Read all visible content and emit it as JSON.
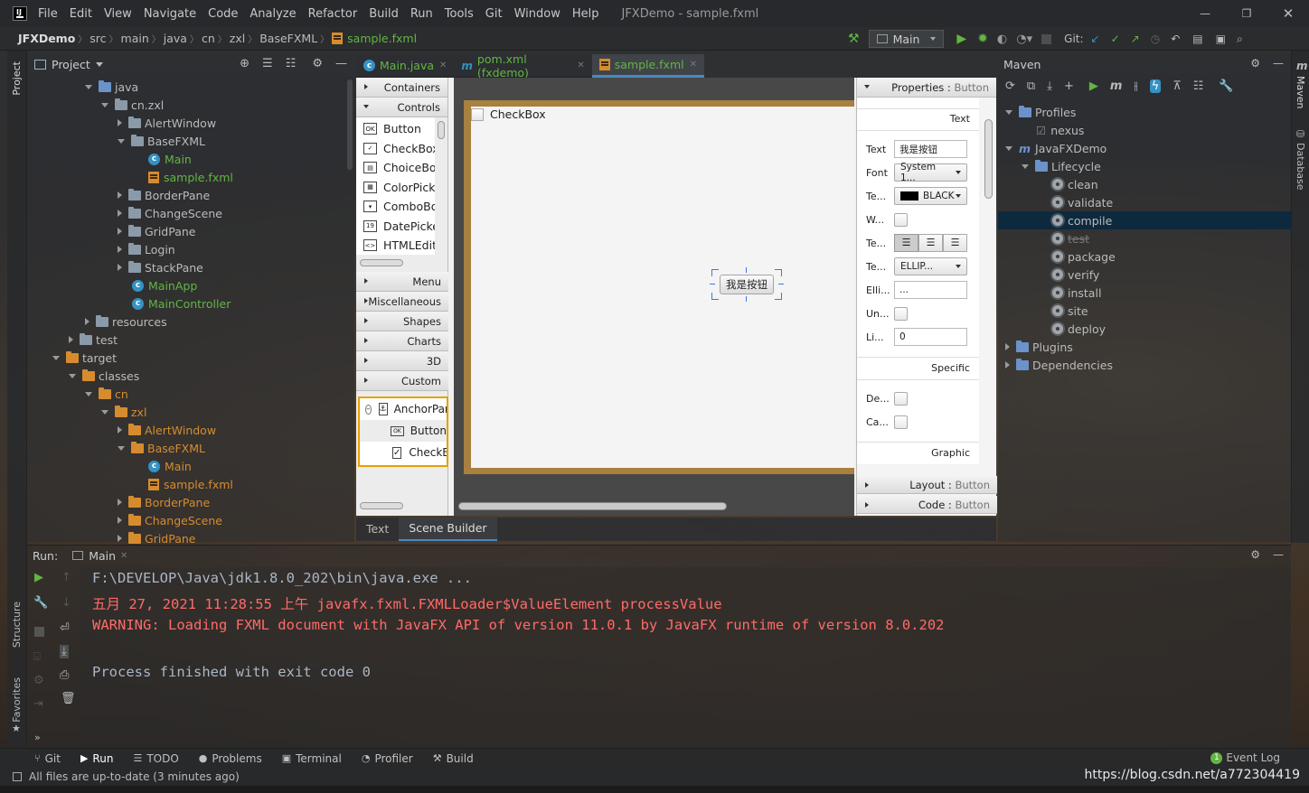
{
  "title_bar": {
    "menus": [
      "File",
      "Edit",
      "View",
      "Navigate",
      "Code",
      "Analyze",
      "Refactor",
      "Build",
      "Run",
      "Tools",
      "Git",
      "Window",
      "Help"
    ],
    "window_title": "JFXDemo - sample.fxml"
  },
  "breadcrumb": [
    "JFXDemo",
    "src",
    "main",
    "java",
    "cn",
    "zxl",
    "BaseFXML",
    "sample.fxml"
  ],
  "toolbar": {
    "run_config": "Main",
    "git_label": "Git:"
  },
  "project": {
    "header": "Project",
    "side_tab": "Project"
  },
  "tree": [
    {
      "label": "java",
      "depth": 3,
      "arrow": "d",
      "icon": "folder-b",
      "color": ""
    },
    {
      "label": "cn.zxl",
      "depth": 4,
      "arrow": "d",
      "icon": "folder",
      "color": ""
    },
    {
      "label": "AlertWindow",
      "depth": 5,
      "arrow": "r",
      "icon": "folder",
      "color": ""
    },
    {
      "label": "BaseFXML",
      "depth": 5,
      "arrow": "d",
      "icon": "folder",
      "color": ""
    },
    {
      "label": "Main",
      "depth": 6,
      "arrow": "",
      "icon": "class",
      "color": "green"
    },
    {
      "label": "sample.fxml",
      "depth": 6,
      "arrow": "",
      "icon": "fxml",
      "color": "green"
    },
    {
      "label": "BorderPane",
      "depth": 5,
      "arrow": "r",
      "icon": "folder",
      "color": ""
    },
    {
      "label": "ChangeScene",
      "depth": 5,
      "arrow": "r",
      "icon": "folder",
      "color": ""
    },
    {
      "label": "GridPane",
      "depth": 5,
      "arrow": "r",
      "icon": "folder",
      "color": ""
    },
    {
      "label": "Login",
      "depth": 5,
      "arrow": "r",
      "icon": "folder",
      "color": ""
    },
    {
      "label": "StackPane",
      "depth": 5,
      "arrow": "r",
      "icon": "folder",
      "color": ""
    },
    {
      "label": "MainApp",
      "depth": 5,
      "arrow": "",
      "icon": "class",
      "color": "green"
    },
    {
      "label": "MainController",
      "depth": 5,
      "arrow": "",
      "icon": "class",
      "color": "green"
    },
    {
      "label": "resources",
      "depth": 3,
      "arrow": "r",
      "icon": "folder",
      "color": ""
    },
    {
      "label": "test",
      "depth": 2,
      "arrow": "r",
      "icon": "folder",
      "color": ""
    },
    {
      "label": "target",
      "depth": 1,
      "arrow": "d",
      "icon": "folder-o",
      "color": ""
    },
    {
      "label": "classes",
      "depth": 2,
      "arrow": "d",
      "icon": "folder-o",
      "color": ""
    },
    {
      "label": "cn",
      "depth": 3,
      "arrow": "d",
      "icon": "folder-o",
      "color": "orange"
    },
    {
      "label": "zxl",
      "depth": 4,
      "arrow": "d",
      "icon": "folder-o",
      "color": "orange"
    },
    {
      "label": "AlertWindow",
      "depth": 5,
      "arrow": "r",
      "icon": "folder-o",
      "color": "orange"
    },
    {
      "label": "BaseFXML",
      "depth": 5,
      "arrow": "d",
      "icon": "folder-o",
      "color": "orange"
    },
    {
      "label": "Main",
      "depth": 6,
      "arrow": "",
      "icon": "class",
      "color": "orange"
    },
    {
      "label": "sample.fxml",
      "depth": 6,
      "arrow": "",
      "icon": "fxml",
      "color": "orange"
    },
    {
      "label": "BorderPane",
      "depth": 5,
      "arrow": "r",
      "icon": "folder-o",
      "color": "orange"
    },
    {
      "label": "ChangeScene",
      "depth": 5,
      "arrow": "r",
      "icon": "folder-o",
      "color": "orange"
    },
    {
      "label": "GridPane",
      "depth": 5,
      "arrow": "r",
      "icon": "folder-o",
      "color": "orange"
    }
  ],
  "editor_tabs": [
    "Main.java",
    "pom.xml (fxdemo)",
    "sample.fxml"
  ],
  "library": {
    "sections_top": [
      "Containers",
      "Controls"
    ],
    "controls": [
      "Button",
      "CheckBox",
      "ChoiceBox",
      "ColorPicker",
      "ComboBox",
      "DatePicker",
      "HTMLEditor"
    ],
    "sections_bottom": [
      "Menu",
      "Miscellaneous",
      "Shapes",
      "Charts",
      "3D",
      "Custom"
    ]
  },
  "hierarchy": [
    "AnchorPane",
    "Button",
    "CheckBox"
  ],
  "canvas": {
    "checkbox_label": "CheckBox",
    "button_label": "我是按钮"
  },
  "inspector": {
    "properties_header": "Properties",
    "properties_target": "Button",
    "section_text": "Text",
    "text_label": "Text",
    "text_value": "我是按钮",
    "font_label": "Font",
    "font_value": "System 1...",
    "te1_label": "Te...",
    "color_value": "BLACK",
    "w_label": "W...",
    "te2_label": "Te...",
    "te3_label": "Te...",
    "overrun_value": "ELLIP...",
    "elli_label": "Elli...",
    "elli_value": "...",
    "un_label": "Un...",
    "li_label": "Li...",
    "li_value": "0",
    "section_specific": "Specific",
    "de_label": "De...",
    "ca_label": "Ca...",
    "section_graphic": "Graphic",
    "layout_header": "Layout",
    "code_header": "Code"
  },
  "bottom_editor_tabs": [
    "Text",
    "Scene Builder"
  ],
  "maven": {
    "header": "Maven",
    "side_tab": "Maven",
    "database_tab": "Database",
    "items": [
      {
        "label": "Profiles",
        "depth": 0,
        "arrow": "d",
        "icon": "profiles"
      },
      {
        "label": "nexus",
        "depth": 1,
        "arrow": "",
        "icon": "check"
      },
      {
        "label": "JavaFXDemo",
        "depth": 0,
        "arrow": "d",
        "icon": "mvn"
      },
      {
        "label": "Lifecycle",
        "depth": 1,
        "arrow": "d",
        "icon": "folder-b"
      },
      {
        "label": "clean",
        "depth": 2,
        "arrow": "",
        "icon": "gear"
      },
      {
        "label": "validate",
        "depth": 2,
        "arrow": "",
        "icon": "gear"
      },
      {
        "label": "compile",
        "depth": 2,
        "arrow": "",
        "icon": "gear",
        "selected": true
      },
      {
        "label": "test",
        "depth": 2,
        "arrow": "",
        "icon": "gear",
        "strike": true
      },
      {
        "label": "package",
        "depth": 2,
        "arrow": "",
        "icon": "gear"
      },
      {
        "label": "verify",
        "depth": 2,
        "arrow": "",
        "icon": "gear"
      },
      {
        "label": "install",
        "depth": 2,
        "arrow": "",
        "icon": "gear"
      },
      {
        "label": "site",
        "depth": 2,
        "arrow": "",
        "icon": "gear"
      },
      {
        "label": "deploy",
        "depth": 2,
        "arrow": "",
        "icon": "gear"
      },
      {
        "label": "Plugins",
        "depth": 0,
        "arrow": "r",
        "icon": "folder-b"
      },
      {
        "label": "Dependencies",
        "depth": 0,
        "arrow": "r",
        "icon": "folder-b"
      }
    ]
  },
  "run": {
    "label": "Run:",
    "tab": "Main",
    "lines": [
      {
        "text": "F:\\DEVELOP\\Java\\jdk1.8.0_202\\bin\\java.exe ...",
        "color": "#a9b7c6"
      },
      {
        "text": "五月 27, 2021 11:28:55 上午 javafx.fxml.FXMLLoader$ValueElement processValue",
        "color": "#ff6b68"
      },
      {
        "text": "WARNING: Loading FXML document with JavaFX API of version 11.0.1 by JavaFX runtime of version 8.0.202",
        "color": "#ff6b68"
      },
      {
        "text": "",
        "color": "#a9b7c6"
      },
      {
        "text": "Process finished with exit code 0",
        "color": "#a9b7c6"
      }
    ]
  },
  "left_side_tabs": [
    "Structure",
    "Favorites"
  ],
  "bottom_tabs": [
    "Git",
    "Run",
    "TODO",
    "Problems",
    "Terminal",
    "Profiler",
    "Build"
  ],
  "event_log": {
    "count": "1",
    "label": "Event Log"
  },
  "status": {
    "text": "All files are up-to-date (3 minutes ago)",
    "watermark": "https://blog.csdn.net/a772304419"
  }
}
